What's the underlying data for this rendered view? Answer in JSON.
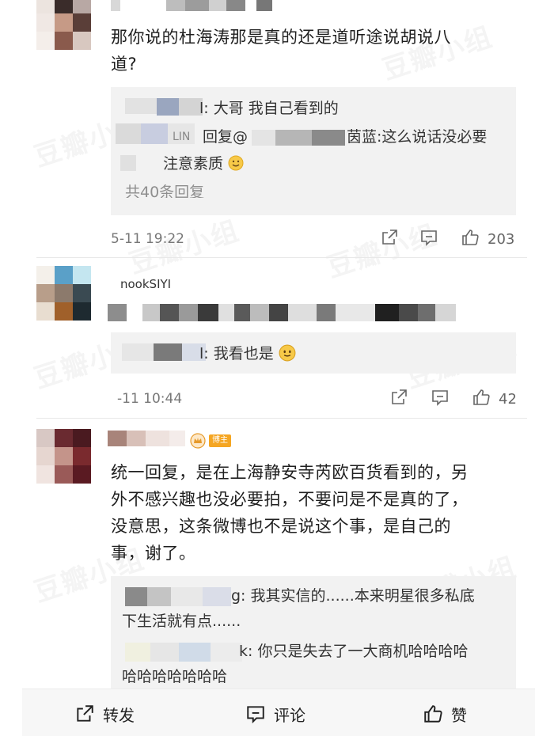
{
  "watermark": "豆瓣小组",
  "comments": [
    {
      "text": "那你说的杜海涛那是真的还是道听途说胡说八道?",
      "text_line1": "那你说的杜海涛那是真的还是道听途说胡说八",
      "text_line2": "道?",
      "replies": [
        {
          "nick_tail": "l:",
          "text": "大哥 我自己看到的"
        },
        {
          "nick_tail": "LIN",
          "text": "回复@",
          "mid": "茵蓝:这么说话没必要"
        },
        {
          "text": "注意素质"
        },
        {
          "text": "共40条回复"
        }
      ],
      "time": "5-11 19:22",
      "likes": "203"
    },
    {
      "nick_partial": "nookSIYI",
      "replies": [
        {
          "nick_tail": "l:",
          "text": "我看也是"
        }
      ],
      "time": "-11 10:44",
      "likes": "42"
    },
    {
      "badge": "博主",
      "text_line1": "统一回复，是在上海静安寺芮欧百货看到的，另",
      "text_line2": "外不感兴趣也没必要拍，不要问是不是真的了，",
      "text_line3": "没意思，这条微博也不是说这个事，是自己的",
      "text_line4": "事，谢了。",
      "replies": [
        {
          "nick_tail": "g:",
          "text_line1": "我其实信的......本来明星很多私底",
          "text_line2": "下生活就有点......"
        },
        {
          "nick_tail": "k:",
          "text_line1": "你只是失去了一大商机哈哈哈哈",
          "text_line2": "哈哈哈哈哈哈哈"
        }
      ]
    }
  ],
  "bottom_bar": {
    "repost_label": "转发",
    "comment_label": "评论",
    "like_label": "赞"
  },
  "icons": {
    "repost": "share-icon",
    "comment": "comment-icon",
    "like": "thumbs-up-icon",
    "emoji": "smile-emoji-icon"
  },
  "colors": {
    "badge": "#f5a623",
    "reply_bg": "#f2f2f2",
    "meta": "#777777"
  }
}
